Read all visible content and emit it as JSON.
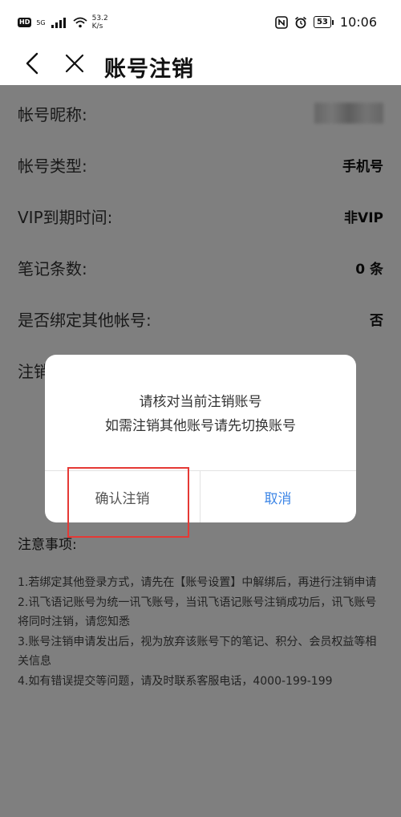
{
  "status_bar": {
    "hd": "HD",
    "net_gen": "5G",
    "speed_value": "53.2",
    "speed_unit": "K/s",
    "battery": "53",
    "time": "10:06"
  },
  "header": {
    "title": "账号注销"
  },
  "info_rows": [
    {
      "label": "帐号昵称:",
      "value": ""
    },
    {
      "label": "帐号类型:",
      "value": "手机号"
    },
    {
      "label": "VIP到期时间:",
      "value": "非VIP"
    },
    {
      "label": "笔记条数:",
      "value": "0 条"
    },
    {
      "label": "是否绑定其他帐号:",
      "value": "否"
    },
    {
      "label": "注销",
      "value": ""
    }
  ],
  "notes": {
    "title": "注意事项:",
    "items": [
      "1.若绑定其他登录方式，请先在【账号设置】中解绑后，再进行注销申请",
      "2.讯飞语记账号为统一讯飞账号，当讯飞语记账号注销成功后，讯飞账号将同时注销，请您知悉",
      "3.账号注销申请发出后，视为放弃该账号下的笔记、积分、会员权益等相关信息",
      "4.如有错误提交等问题，请及时联系客服电话，4000-199-199"
    ]
  },
  "dialog": {
    "line1": "请核对当前注销账号",
    "line2": "如需注销其他账号请先切换账号",
    "confirm_label": "确认注销",
    "cancel_label": "取消"
  },
  "colors": {
    "cancel": "#3d86e6",
    "highlight": "#e53935"
  }
}
